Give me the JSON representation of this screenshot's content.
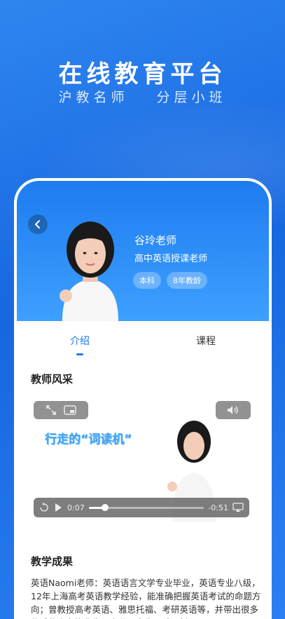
{
  "banner": {
    "headline": "在线教育平台",
    "sub_left": "沪教名师",
    "sub_right": "分层小班"
  },
  "profile": {
    "name": "谷玲老师",
    "role": "高中英语授课老师",
    "tags": [
      "本科",
      "8年教龄"
    ]
  },
  "tabs": [
    {
      "label": "介绍",
      "active": true
    },
    {
      "label": "课程",
      "active": false
    }
  ],
  "sections": {
    "style_title": "教师风采",
    "result_title": "教学成果"
  },
  "video": {
    "caption": "行走的“词读机”",
    "current_time": "0:07",
    "remaining_time": "-0:51",
    "progress": 0.14
  },
  "description": "英语Naomi老师：英语语言文学专业毕业，英语专业八级，12年上海高考英语教学经验，能准确把握英语考试的命题方向；曾教授高考英语、雅思托福、考研英语等，并带出很多优秀的高考毕业生、高分研究生、雅思托",
  "colors": {
    "brand_blue": "#1f78ef",
    "background_blue": "#1767e0"
  }
}
